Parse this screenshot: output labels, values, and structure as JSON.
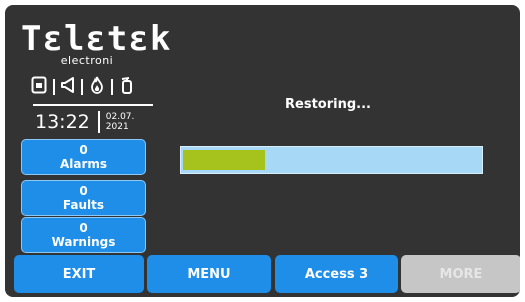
{
  "logo": {
    "brand": "Tεlεtεk",
    "sub": "electroni"
  },
  "status_icons": [
    "power-supply-icon",
    "siren-icon",
    "fire-icon",
    "extinguisher-icon"
  ],
  "clock": {
    "time": "13:22",
    "date_day_month": "02.07.",
    "date_year": "2021"
  },
  "side_buttons": [
    {
      "count": "0",
      "label": "Alarms"
    },
    {
      "count": "0",
      "label": "Faults"
    },
    {
      "count": "0",
      "label": "Warnings"
    }
  ],
  "main": {
    "status": "Restoring...",
    "progress": 0.28
  },
  "bottom_buttons": [
    {
      "label": "EXIT",
      "enabled": true
    },
    {
      "label": "MENU",
      "enabled": true
    },
    {
      "label": "Access 3",
      "enabled": true
    },
    {
      "label": "MORE",
      "enabled": false
    }
  ],
  "colors": {
    "background": "#333333",
    "button": "#1e8ee8",
    "button_disabled": "#c6c6c6",
    "progress_track": "#a7d8f6",
    "progress_fill": "#a6c21c"
  }
}
